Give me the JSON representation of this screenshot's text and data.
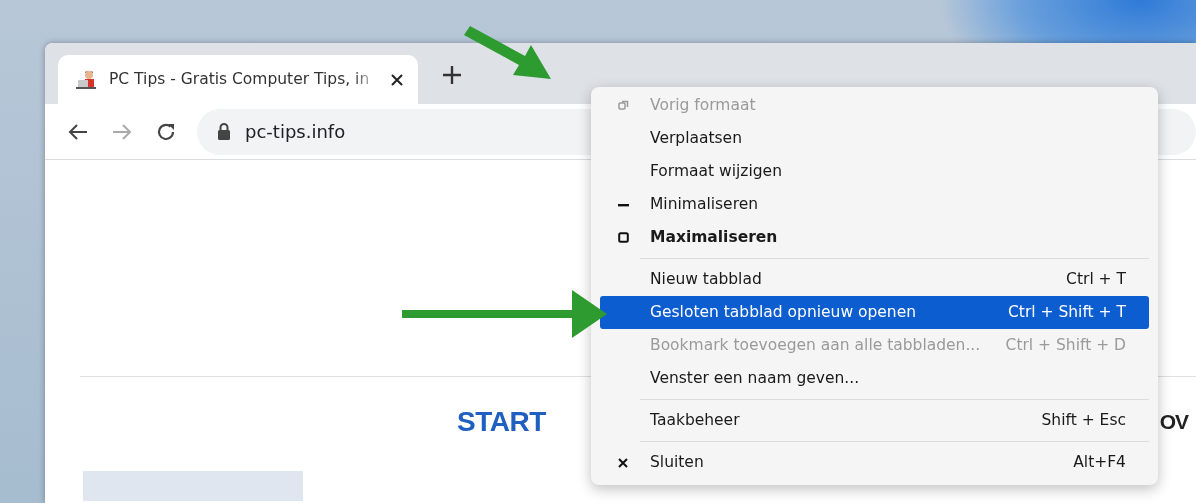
{
  "browser": {
    "tab": {
      "title": "PC Tips - Gratis Computer Tips, in",
      "selected": true
    },
    "address": "pc-tips.info"
  },
  "page": {
    "nav_items": [
      "START",
      "OV"
    ]
  },
  "context_menu": [
    {
      "kind": "restore",
      "label": "Vorig formaat",
      "disabled": true,
      "selected": false,
      "bold": false
    },
    {
      "kind": "item",
      "label": "Verplaatsen",
      "disabled": false,
      "selected": false,
      "bold": false
    },
    {
      "kind": "item",
      "label": "Formaat wijzigen",
      "disabled": false,
      "selected": false,
      "bold": false
    },
    {
      "kind": "minimize",
      "label": "Minimaliseren",
      "disabled": false,
      "selected": false,
      "bold": false
    },
    {
      "kind": "maximize",
      "label": "Maximaliseren",
      "disabled": false,
      "selected": false,
      "bold": true
    },
    {
      "kind": "separator"
    },
    {
      "kind": "item",
      "label": "Nieuw tabblad",
      "shortcut": "Ctrl + T",
      "disabled": false,
      "selected": false,
      "bold": false
    },
    {
      "kind": "item",
      "label": "Gesloten tabblad opnieuw openen",
      "shortcut": "Ctrl + Shift + T",
      "disabled": false,
      "selected": true,
      "bold": false
    },
    {
      "kind": "item",
      "label": "Bookmark toevoegen aan alle tabbladen...",
      "shortcut": "Ctrl + Shift + D",
      "disabled": true,
      "selected": false,
      "bold": false
    },
    {
      "kind": "item",
      "label": "Venster een naam geven...",
      "disabled": false,
      "selected": false,
      "bold": false
    },
    {
      "kind": "separator"
    },
    {
      "kind": "item",
      "label": "Taakbeheer",
      "shortcut": "Shift + Esc",
      "disabled": false,
      "selected": false,
      "bold": false
    },
    {
      "kind": "separator"
    },
    {
      "kind": "close",
      "label": "Sluiten",
      "shortcut": "Alt+F4",
      "disabled": false,
      "selected": false,
      "bold": false
    }
  ]
}
